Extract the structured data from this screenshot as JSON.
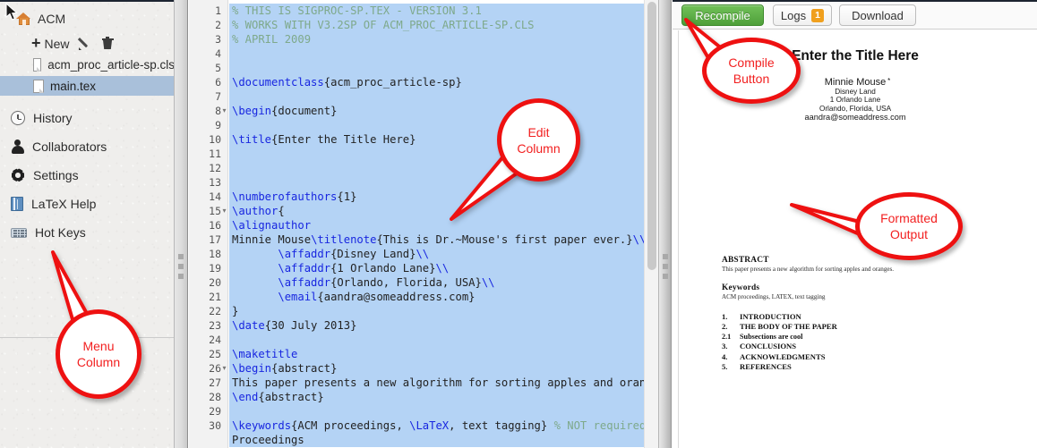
{
  "sidebar": {
    "project": {
      "label": "ACM",
      "icon": "home-icon"
    },
    "tools": {
      "new_label": "New",
      "plus": "+",
      "rename_icon": "pencil-icon",
      "delete_icon": "trash-icon"
    },
    "files": [
      {
        "label": "acm_proc_article-sp.cls",
        "selected": false
      },
      {
        "label": "main.tex",
        "selected": true
      }
    ],
    "menu": [
      {
        "label": "History",
        "icon": "clock-icon"
      },
      {
        "label": "Collaborators",
        "icon": "user-icon"
      },
      {
        "label": "Settings",
        "icon": "gear-icon"
      },
      {
        "label": "LaTeX Help",
        "icon": "book-icon"
      },
      {
        "label": "Hot Keys",
        "icon": "keyboard-icon"
      }
    ]
  },
  "editor": {
    "line_numbers": [
      "1",
      "2",
      "3",
      "4",
      "5",
      "6",
      "7",
      "8",
      "9",
      "10",
      "11",
      "12",
      "13",
      "14",
      "15",
      "16",
      "17",
      "18",
      "19",
      "20",
      "21",
      "22",
      "23",
      "24",
      "25",
      "26",
      "27",
      "28",
      "29",
      "30"
    ],
    "fold_lines": [
      "8",
      "15",
      "26"
    ],
    "lines": [
      "% THIS IS SIGPROC-SP.TEX - VERSION 3.1",
      "% WORKS WITH V3.2SP OF ACM_PROC_ARTICLE-SP.CLS",
      "% APRIL 2009",
      "",
      "",
      "\\documentclass{acm_proc_article-sp}",
      "",
      "\\begin{document}",
      "",
      "\\title{Enter the Title Here}",
      "",
      "",
      "",
      "\\numberofauthors{1}",
      "\\author{",
      "\\alignauthor",
      "Minnie Mouse\\titlenote{This is Dr.~Mouse's first paper ever.}\\\\",
      "       \\affaddr{Disney Land}\\\\",
      "       \\affaddr{1 Orlando Lane}\\\\",
      "       \\affaddr{Orlando, Florida, USA}\\\\",
      "       \\email{aandra@someaddress.com}",
      "}",
      "\\date{30 July 2013}",
      "",
      "\\maketitle",
      "\\begin{abstract}",
      "This paper presents a new algorithm for sorting apples and oranges.",
      "\\end{abstract}",
      "",
      "\\keywords{ACM proceedings, \\LaTeX, text tagging} % NOT required for",
      "Proceedings"
    ]
  },
  "preview": {
    "toolbar": {
      "recompile_label": "Recompile",
      "logs_label": "Logs",
      "logs_count": "1",
      "download_label": "Download"
    },
    "document": {
      "title": "Enter the Title Here",
      "author": "Minnie Mouse",
      "author_note_mark": "*",
      "affiliations": [
        "Disney Land",
        "1 Orlando Lane",
        "Orlando, Florida, USA"
      ],
      "email": "aandra@someaddress.com",
      "abstract_heading": "ABSTRACT",
      "abstract_text": "This paper presents a new algorithm for sorting apples and oranges.",
      "keywords_heading": "Keywords",
      "keywords_text": "ACM proceedings, LATEX, text tagging",
      "sections": [
        {
          "num": "1.",
          "title": "INTRODUCTION",
          "sub": false
        },
        {
          "num": "2.",
          "title": "THE BODY OF THE PAPER",
          "sub": false
        },
        {
          "num": "2.1",
          "title": "Subsections are cool",
          "sub": true
        },
        {
          "num": "3.",
          "title": "CONCLUSIONS",
          "sub": false
        },
        {
          "num": "4.",
          "title": "ACKNOWLEDGMENTS",
          "sub": false
        },
        {
          "num": "5.",
          "title": "REFERENCES",
          "sub": false
        }
      ]
    }
  },
  "annotations": {
    "color": "#EE1111",
    "menu": {
      "line1": "Menu",
      "line2": "Column"
    },
    "edit": {
      "line1": "Edit",
      "line2": "Column"
    },
    "compile": {
      "line1": "Compile",
      "line2": "Button"
    },
    "output": {
      "line1": "Formatted",
      "line2": "Output"
    }
  }
}
